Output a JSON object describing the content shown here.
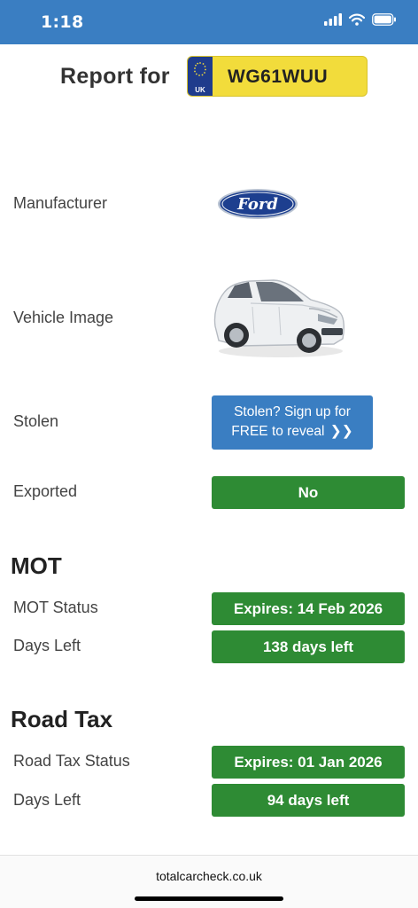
{
  "status_bar": {
    "time": "1:18"
  },
  "header": {
    "report_label": "Report for",
    "plate_country": "UK",
    "plate_number": "WG61WUU"
  },
  "rows": {
    "manufacturer_label": "Manufacturer",
    "vehicle_image_label": "Vehicle Image",
    "stolen_label": "Stolen",
    "stolen_button_line1": "Stolen? Sign up for",
    "stolen_button_line2": "FREE to reveal",
    "stolen_button_arrow": "❯❯",
    "exported_label": "Exported",
    "exported_value": "No"
  },
  "manufacturer": {
    "logo_text": "Ford",
    "logo_color": "#1d3f8f"
  },
  "mot": {
    "title": "MOT",
    "status_label": "MOT Status",
    "status_value": "Expires: 14 Feb 2026",
    "days_label": "Days Left",
    "days_value": "138 days left"
  },
  "road_tax": {
    "title": "Road Tax",
    "status_label": "Road Tax Status",
    "status_value": "Expires: 01 Jan 2026",
    "days_label": "Days Left",
    "days_value": "94 days left"
  },
  "footer": {
    "url": "totalcarcheck.co.uk"
  },
  "colors": {
    "status_bar": "#3a7ec2",
    "green": "#2e8b34",
    "blue_button": "#3a7ec2",
    "plate_yellow": "#f2dc3b",
    "plate_band": "#1f3c8c"
  }
}
